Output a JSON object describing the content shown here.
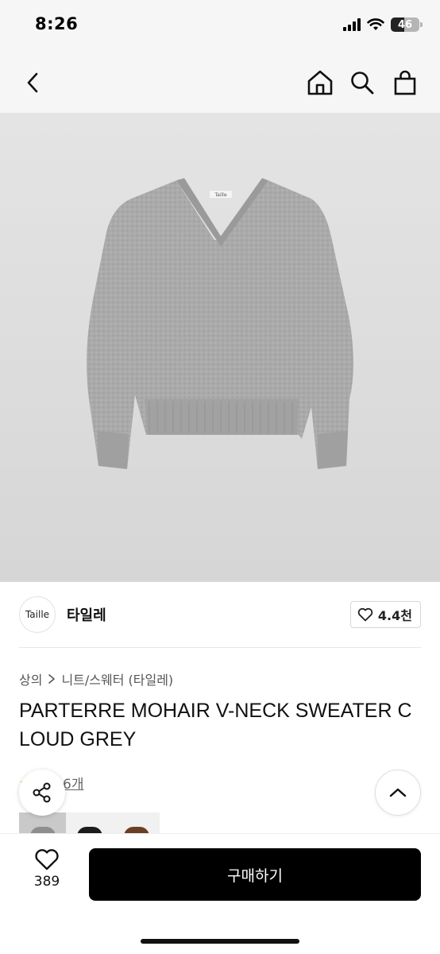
{
  "status_bar": {
    "time": "8:26",
    "battery_level": "46",
    "icons": [
      "cellular-signal-icon",
      "wifi-icon",
      "battery-icon"
    ]
  },
  "nav": {
    "icons": [
      "chevron-left-icon",
      "home-icon",
      "search-icon",
      "shopping-bag-icon"
    ]
  },
  "product_image": {
    "garment_label": "Taille"
  },
  "brand": {
    "logo_text": "Taille",
    "name": "타일레",
    "like_count": "4.4천"
  },
  "breadcrumb": {
    "items": [
      "상의",
      "니트/스웨터 (타일레)"
    ]
  },
  "product": {
    "title": "PARTERRE MOHAIR V-NECK SWEATER CLOUD GREY"
  },
  "reviews": {
    "label": "후기 6개"
  },
  "floating": {
    "icons": [
      "share-icon",
      "chevron-up-icon"
    ]
  },
  "bottom_bar": {
    "wish_count": "389",
    "buy_label": "구매하기"
  },
  "colors": {
    "background": "#ffffff",
    "header_bg": "#f6f6f6",
    "buy_button": "#000000",
    "review_star": "#f2b705",
    "sweater": "#a9a9a9"
  }
}
